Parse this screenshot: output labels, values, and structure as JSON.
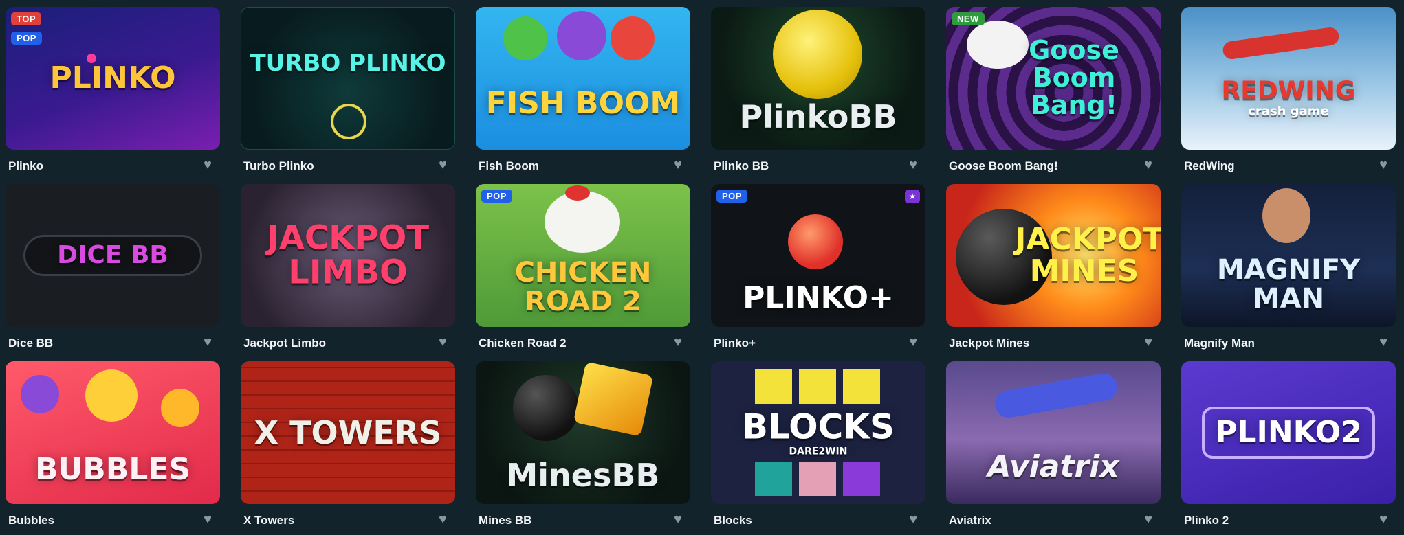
{
  "games": [
    {
      "title": "Plinko",
      "art": "PLINKO",
      "badges": [
        "TOP",
        "POP"
      ]
    },
    {
      "title": "Turbo Plinko",
      "art": "TURBO PLINKO"
    },
    {
      "title": "Fish Boom",
      "art": "FISH BOOM"
    },
    {
      "title": "Plinko BB",
      "art": "PlinkoBB"
    },
    {
      "title": "Goose Boom Bang!",
      "art": "Goose Boom Bang!",
      "badges": [
        "NEW"
      ]
    },
    {
      "title": "RedWing",
      "art": "REDWING",
      "art_sub": "crash game"
    },
    {
      "title": "Dice BB",
      "art": "DICE BB"
    },
    {
      "title": "Jackpot Limbo",
      "art": "JACKPOT LIMBO"
    },
    {
      "title": "Chicken Road 2",
      "art": "CHICKEN ROAD 2",
      "badges": [
        "POP"
      ]
    },
    {
      "title": "Plinko+",
      "art": "PLINKO+",
      "badges": [
        "POP"
      ]
    },
    {
      "title": "Jackpot Mines",
      "art": "JACKPOT MINES"
    },
    {
      "title": "Magnify Man",
      "art": "MAGNIFY MAN"
    },
    {
      "title": "Bubbles",
      "art": "BUBBLES"
    },
    {
      "title": "X Towers",
      "art": "X TOWERS"
    },
    {
      "title": "Mines BB",
      "art": "MinesBB"
    },
    {
      "title": "Blocks",
      "art": "BLOCKS",
      "art_sub": "DARE2WIN"
    },
    {
      "title": "Aviatrix",
      "art": "Aviatrix"
    },
    {
      "title": "Plinko 2",
      "art": "PLINKO2"
    }
  ],
  "icons": {
    "favorite": "heart-icon",
    "trophy": "trophy-icon"
  },
  "colors": {
    "background": "#13232b",
    "badge_top": "#e0413a",
    "badge_pop": "#2160e8",
    "badge_new": "#2f9b3e"
  }
}
